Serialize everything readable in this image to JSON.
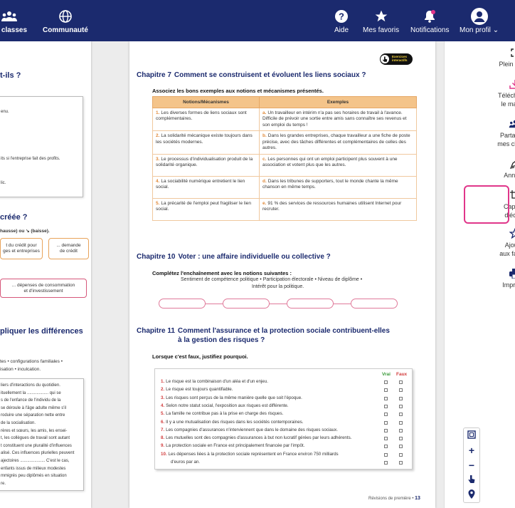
{
  "topbar": {
    "nav_left": [
      {
        "label": "es classes",
        "icon": "share-classes-icon"
      },
      {
        "label": "Communauté",
        "icon": "globe-icon"
      }
    ],
    "nav_right": [
      {
        "label": "Aide",
        "icon": "help-icon"
      },
      {
        "label": "Mes favoris",
        "icon": "star-icon"
      },
      {
        "label": "Notifications",
        "icon": "bell-icon"
      },
      {
        "label": "Mon profil",
        "icon": "avatar-icon"
      }
    ],
    "colors": {
      "bar": "#1b2a6e",
      "notif_dot": "#e0368a"
    }
  },
  "left_page": {
    "heading1": "t-ils ?",
    "box1_lines": [
      "enu.",
      "its si l'entreprise fait des profits.",
      "lic."
    ],
    "heading2": "créée ?",
    "subline": "hausse) ou ↘ (baisse).",
    "flow1": "t du crédit pour\nges et entreprises",
    "flow2": "... demande\nde crédit",
    "flow3": "... dépenses de consommation\net d'investissement",
    "heading3": "pliquer les différences",
    "keywords1": "tes • configurations familiales •",
    "keywords2": "isation • inculcation.",
    "para_lines": [
      "liers d'interactions du quotidien.",
      "ituellement la .................. qui se",
      "s de l'enfance de l'individu de la",
      "se déroule à l'âge adulte même s'il",
      "roduire une séparation nette entre",
      "de la socialisation.",
      "rères et sœurs, les amis, les ensei-",
      "t, les collègues de travail sont autant",
      "t constituent une pluralité d'influences",
      "alisé. Ces influences plurielles peuvent",
      "ajectoires ..................... C'est le cas,",
      "enfants issus de milieux modestes",
      "mmigrés peu diplômés en situation",
      "re."
    ]
  },
  "main_page": {
    "badge_line1": "Exercices",
    "badge_line2": "interactifs",
    "ch7_num": "Chapitre 7",
    "ch7_title": "Comment se construisent et évoluent les liens sociaux ?",
    "ch7_instr": "Associez les bons exemples aux notions et mécanismes présentés.",
    "table": {
      "headers": [
        "Notions/Mécanismes",
        "Exemples"
      ],
      "rows": [
        {
          "n": "1.",
          "notion": "Les diverses formes de liens sociaux sont complémentaires.",
          "l": "a.",
          "example": "Un travailleur en intérim n'a pas ses horaires de travail à l'avance. Difficile de prévoir une sortie entre amis sans connaître ses revenus et son emploi du temps !"
        },
        {
          "n": "2.",
          "notion": "La solidarité mécanique existe toujours dans les sociétés modernes.",
          "l": "b.",
          "example": "Dans les grandes entreprises, chaque travailleur a une fiche de poste précise, avec des tâches différentes et complémentaires de celles des autres."
        },
        {
          "n": "3.",
          "notion": "Le processus d'individualisation produit de la solidarité organique.",
          "l": "c.",
          "example": "Les personnes qui ont un emploi participent plus souvent à une association et votent plus que les autres."
        },
        {
          "n": "4.",
          "notion": "La sociabilité numérique entretient le lien social.",
          "l": "d.",
          "example": "Dans les tribunes de supporters, tout le monde chante la même chanson en même temps."
        },
        {
          "n": "5.",
          "notion": "La précarité de l'emploi peut fragiliser le lien social.",
          "l": "e.",
          "example": "91 % des services de ressources humaines utilisent Internet pour recruter."
        }
      ]
    },
    "ch10_num": "Chapitre 10",
    "ch10_title": "Voter : une affaire individuelle ou collective ?",
    "ch10_instr": "Complétez l'enchaînement avec les notions suivantes :",
    "ch10_words1": "Sentiment de compétence politique • Participation électorale • Niveau de diplôme •",
    "ch10_words2": "Intérêt pour la politique.",
    "ch11_num": "Chapitre 11",
    "ch11_title1": "Comment l'assurance et la protection sociale contribuent-elles",
    "ch11_title2": "à la gestion des risques ?",
    "ch11_instr": "Lorsque c'est faux, justifiez pourquoi.",
    "vrai": "Vrai",
    "faux": "Faux",
    "statements": [
      {
        "n": "1.",
        "t": "Le risque est la combinaison d'un aléa et d'un enjeu."
      },
      {
        "n": "2.",
        "t": "Le risque est toujours quantifiable."
      },
      {
        "n": "3.",
        "t": "Les risques sont perçus de la même manière quelle que soit l'époque."
      },
      {
        "n": "4.",
        "t": "Selon notre statut social, l'exposition aux risques est différente."
      },
      {
        "n": "5.",
        "t": "La famille ne contribue pas à la prise en charge des risques."
      },
      {
        "n": "6.",
        "t": "Il y a une mutualisation des risques dans les sociétés contemporaines."
      },
      {
        "n": "7.",
        "t": "Les compagnies d'assurances n'interviennent que dans le domaine des risques sociaux."
      },
      {
        "n": "8.",
        "t": "Les mutuelles sont des compagnies d'assurances à but non lucratif gérées par leurs adhérents."
      },
      {
        "n": "9.",
        "t": "La protection sociale en France est principalement financée par l'impôt."
      },
      {
        "n": "10.",
        "t": "Les dépenses liées à la protection sociale représentent en France environ 750 milliards"
      },
      {
        "n": "",
        "t": "d'euros par an."
      }
    ],
    "footer": "Révisions de première •",
    "page_number": "13"
  },
  "sidebar": {
    "items": [
      {
        "label1": "Plein écran",
        "label2": "",
        "icon": "fullscreen-icon"
      },
      {
        "label1": "Télécharger",
        "label2": "le manuel",
        "icon": "download-icon"
      },
      {
        "label1": "Partager à",
        "label2": "mes classes",
        "icon": "share-classes-icon"
      },
      {
        "label1": "Annoter",
        "label2": "",
        "icon": "annotate-icon"
      },
      {
        "label1": "Capture",
        "label2": "d'écran",
        "icon": "screenshot-icon"
      },
      {
        "label1": "Ajouter",
        "label2": "aux favoris",
        "icon": "star-outline-icon"
      },
      {
        "label1": "Imprimer",
        "label2": "",
        "icon": "print-icon"
      }
    ],
    "highlight_color": "#e0368a",
    "download_color": "#e0368a"
  },
  "zoom_tools": [
    "frame-icon",
    "zoom-in-icon",
    "zoom-out-icon",
    "pointer-hand-icon",
    "location-pin-icon"
  ],
  "next_page_icon": "chevron-right-icon"
}
